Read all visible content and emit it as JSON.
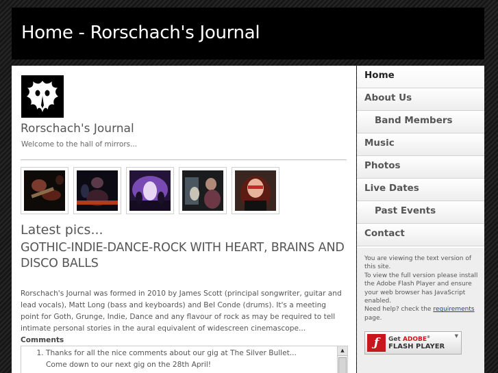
{
  "header": {
    "title": "Home - Rorschach's Journal"
  },
  "site": {
    "title": "Rorschach's Journal",
    "tagline": "Welcome to the hall of mirrors..."
  },
  "gallery": {
    "photos": [
      "band-photo-1",
      "band-photo-2",
      "band-photo-3",
      "band-photo-4",
      "band-photo-5"
    ]
  },
  "main": {
    "latest_heading": "Latest pics...",
    "tagline_heading": "GOTHIC-INDIE-DANCE-ROCK WITH HEART, BRAINS AND DISCO BALLS",
    "intro": "Rorschach's Journal was formed in 2010 by James Scott (principal songwriter, guitar and lead vocals), Matt Long (bass and keyboards) and Bel Conde (drums). It's a meeting point for Goth, Grunge, Indie, Dance and any flavour of rock as may be required to tell intimate personal stories in the aural equivalent of widescreen cinemascope...",
    "comments_label": "Comments",
    "comments": [
      {
        "line1": "Thanks for all the nice comments about our gig at The Silver Bullet...",
        "line2": "Come down to our next gig on the 28th April!"
      }
    ]
  },
  "nav": {
    "items": [
      {
        "label": "Home"
      },
      {
        "label": "About Us"
      },
      {
        "label": "Band Members"
      },
      {
        "label": "Music"
      },
      {
        "label": "Photos"
      },
      {
        "label": "Live Dates"
      },
      {
        "label": "Past Events"
      },
      {
        "label": "Contact"
      }
    ]
  },
  "flash": {
    "text1": "You are viewing the text version of this site.",
    "text2": "To view the full version please install the Adobe Flash Player and ensure your web browser has JavaScript enabled.",
    "text3_prefix": "Need help? check the ",
    "text3_link": "requirements",
    "text3_suffix": " page.",
    "button_line1_prefix": "Get ",
    "button_line1_brand": "ADOBE",
    "button_line2": "FLASH PLAYER",
    "button_icon": "flash-f-icon"
  },
  "colors": {
    "header_bg": "#000000",
    "flash_red": "#c8161d",
    "link_blue": "#1a3f8f"
  }
}
